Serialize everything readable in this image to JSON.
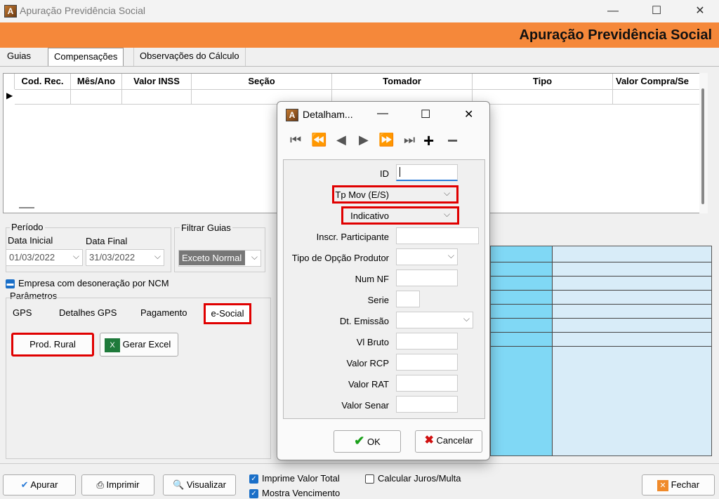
{
  "window": {
    "title": "Apuração Previdência Social",
    "header_title": "Apuração Previdência Social",
    "controls": {
      "minimize": "—",
      "maximize": "☐",
      "close": "✕"
    }
  },
  "tabs": [
    "Guias",
    "Compensações",
    "Observações do Cálculo"
  ],
  "grid": {
    "columns": [
      "Cod. Rec.",
      "Mês/Ano",
      "Valor INSS",
      "Seção",
      "Tomador",
      "Tipo",
      "Valor Compra/Se"
    ]
  },
  "periodo": {
    "label": "Período",
    "data_inicial_label": "Data Inicial",
    "data_inicial": "01/03/2022",
    "data_final_label": "Data Final",
    "data_final": "31/03/2022"
  },
  "filtrar": {
    "label": "Filtrar Guias",
    "value": "Exceto Normal"
  },
  "desoneracao": "Empresa com desoneração por NCM",
  "parametros": {
    "label": "Parâmetros",
    "tabs": [
      "GPS",
      "Detalhes GPS",
      "Pagamento",
      "e-Social"
    ],
    "prod_rural": "Prod. Rural",
    "gerar_excel": "Gerar Excel"
  },
  "bottom": {
    "apurar": "Apurar",
    "imprimir": "Imprimir",
    "visualizar": "Visualizar",
    "imprime_valor_total": "Imprime Valor Total",
    "mostra_vencimento": "Mostra Vencimento",
    "calcular_juros": "Calcular Juros/Multa",
    "fechar": "Fechar"
  },
  "dialog": {
    "title": "Detalham...",
    "controls": {
      "minimize": "—",
      "maximize": "☐",
      "close": "✕"
    },
    "fields": {
      "id": "ID",
      "tp_mov": "Tp Mov (E/S)",
      "indicativo": "Indicativo",
      "inscr": "Inscr. Participante",
      "tipo_opcao": "Tipo de Opção Produtor",
      "num_nf": "Num NF",
      "serie": "Serie",
      "dt_emissao": "Dt. Emissão",
      "vl_bruto": "Vl Bruto",
      "valor_rcp": "Valor RCP",
      "valor_rat": "Valor RAT",
      "valor_senar": "Valor Senar"
    },
    "ok": "OK",
    "cancelar": "Cancelar"
  },
  "icons": {
    "app": "app-logo-icon",
    "check": "checkmark-icon",
    "x": "cancel-x-icon",
    "excel": "excel-icon",
    "printer": "printer-icon",
    "preview": "preview-icon",
    "close_door": "exit-icon"
  },
  "colors": {
    "header": "#f5883a",
    "highlight": "#e00000",
    "grid_cell": "#80d8f5"
  }
}
